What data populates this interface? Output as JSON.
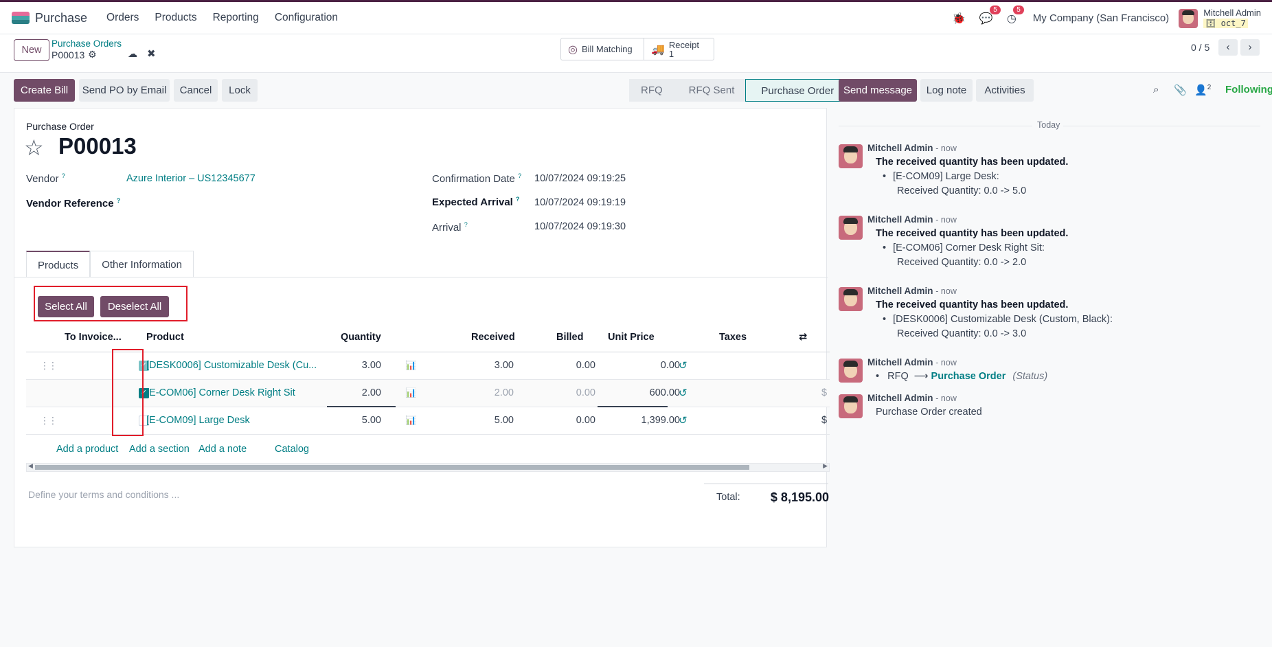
{
  "app": {
    "name": "Purchase",
    "menu": [
      "Orders",
      "Products",
      "Reporting",
      "Configuration"
    ],
    "message_badge": "5",
    "activity_badge": "5",
    "company": "My Company (San Francisco)",
    "user_name": "Mitchell Admin",
    "db_name": "oct_7"
  },
  "breadcrumb": {
    "new_label": "New",
    "parent": "Purchase Orders",
    "current": "P00013"
  },
  "smart_buttons": {
    "bill_matching": "Bill Matching",
    "receipt_label": "Receipt",
    "receipt_count": "1"
  },
  "pager": {
    "text": "0 / 5"
  },
  "actions": {
    "create_bill": "Create Bill",
    "send_po": "Send PO by Email",
    "cancel": "Cancel",
    "lock": "Lock"
  },
  "status_stages": [
    "RFQ",
    "RFQ Sent",
    "Purchase Order"
  ],
  "form": {
    "type_label": "Purchase Order",
    "name": "P00013",
    "vendor_label": "Vendor",
    "vendor_value": "Azure Interior – US12345677",
    "vendor_ref_label": "Vendor Reference",
    "confirmation_label": "Confirmation Date",
    "confirmation_value": "10/07/2024 09:19:25",
    "expected_label": "Expected Arrival",
    "expected_value": "10/07/2024 09:19:19",
    "arrival_label": "Arrival",
    "arrival_value": "10/07/2024 09:19:30",
    "help_mark": "?"
  },
  "tabs": [
    "Products",
    "Other Information"
  ],
  "selection": {
    "select_all": "Select All",
    "deselect_all": "Deselect All"
  },
  "table": {
    "headers": {
      "to_invoice": "To Invoice...",
      "product": "Product",
      "quantity": "Quantity",
      "received": "Received",
      "billed": "Billed",
      "unit_price": "Unit Price",
      "taxes": "Taxes"
    },
    "rows": [
      {
        "checked": true,
        "product": "[DESK0006] Customizable Desk (Cu...",
        "quantity": "3.00",
        "received": "3.00",
        "billed": "0.00",
        "unit_price": "0.00",
        "taxes": ""
      },
      {
        "checked": true,
        "product": "[E-COM06] Corner Desk Right Sit",
        "quantity": "2.00",
        "received": "2.00",
        "billed": "0.00",
        "unit_price": "600.00",
        "taxes": "$"
      },
      {
        "checked": false,
        "product": "[E-COM09] Large Desk",
        "quantity": "5.00",
        "received": "5.00",
        "billed": "0.00",
        "unit_price": "1,399.00",
        "taxes": "$"
      }
    ],
    "add_product": "Add a product",
    "add_section": "Add a section",
    "add_note": "Add a note",
    "catalog": "Catalog"
  },
  "terms_placeholder": "Define your terms and conditions ...",
  "total": {
    "label": "Total:",
    "value": "$ 8,195.00"
  },
  "chatter": {
    "send_message": "Send message",
    "log_note": "Log note",
    "activities": "Activities",
    "followers_count": "2",
    "following": "Following",
    "date_separator": "Today",
    "messages": [
      {
        "author": "Mitchell Admin",
        "time": "- now",
        "title": "The received quantity has been updated.",
        "bullet": "[E-COM09] Large Desk:",
        "detail": "Received Quantity: 0.0 -> 5.0"
      },
      {
        "author": "Mitchell Admin",
        "time": "- now",
        "title": "The received quantity has been updated.",
        "bullet": "[E-COM06] Corner Desk Right Sit:",
        "detail": "Received Quantity: 0.0 -> 2.0"
      },
      {
        "author": "Mitchell Admin",
        "time": "- now",
        "title": "The received quantity has been updated.",
        "bullet": "[DESK0006] Customizable Desk (Custom, Black):",
        "detail": "Received Quantity: 0.0 -> 3.0"
      },
      {
        "author": "Mitchell Admin",
        "time": "- now",
        "from_stage": "RFQ",
        "to_stage": "Purchase Order",
        "field": "(Status)"
      },
      {
        "author": "Mitchell Admin",
        "time": "- now",
        "body": "Purchase Order created"
      }
    ]
  }
}
